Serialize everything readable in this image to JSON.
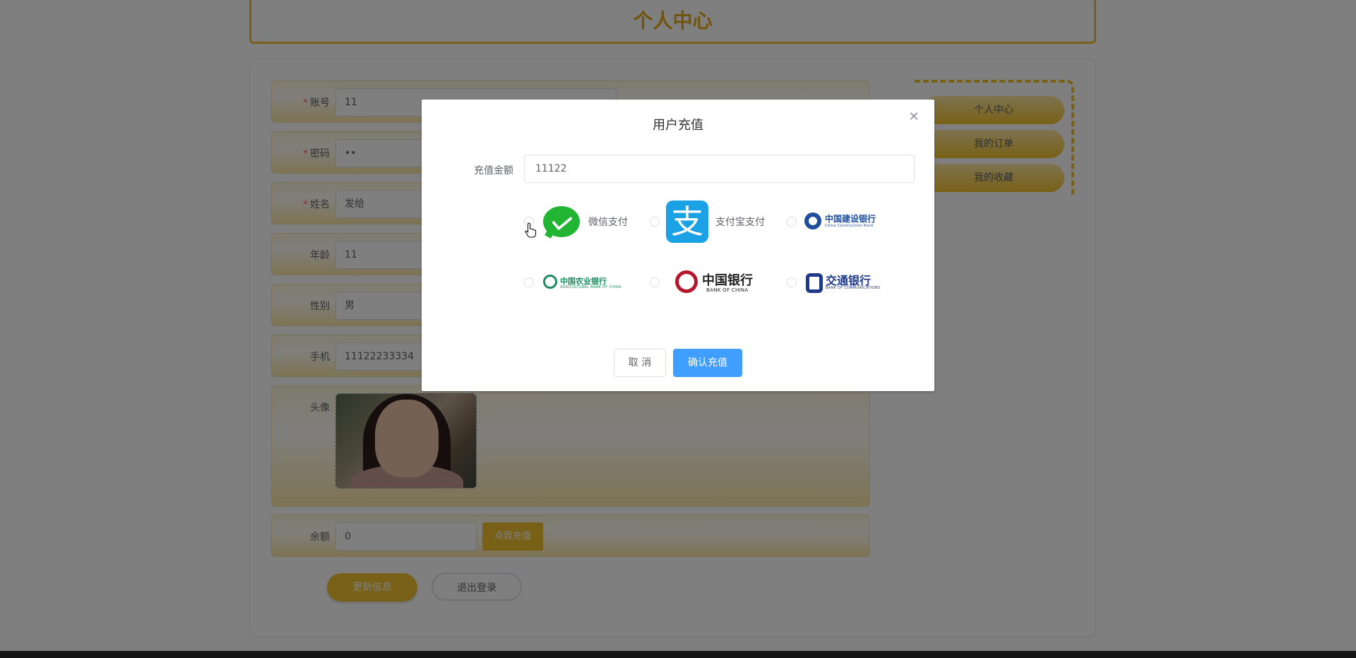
{
  "page": {
    "title": "个人中心"
  },
  "profile_form": {
    "rows": [
      {
        "label": "账号",
        "required": true,
        "value": "11"
      },
      {
        "label": "密码",
        "required": true,
        "value": "••"
      },
      {
        "label": "姓名",
        "required": true,
        "value": "发给"
      },
      {
        "label": "年龄",
        "required": false,
        "value": "11"
      },
      {
        "label": "性别",
        "required": false,
        "value": "男"
      },
      {
        "label": "手机",
        "required": false,
        "value": "11122233334"
      }
    ],
    "required_mark": "*",
    "avatar_label": "头像",
    "balance_label": "余额",
    "balance_value": "0",
    "recharge_link": "点我充值",
    "update_button": "更新信息",
    "logout_button": "退出登录"
  },
  "side_nav": {
    "items": [
      "个人中心",
      "我的订单",
      "我的收藏"
    ]
  },
  "dialog": {
    "title": "用户充值",
    "close_icon": "close-icon",
    "amount_label": "充值金额",
    "amount_value": "11122",
    "payment_options": [
      {
        "name": "wechat",
        "label": "微信支付",
        "color": "#22b533"
      },
      {
        "name": "alipay",
        "label": "支付宝支付",
        "color": "#1aa1e6"
      },
      {
        "name": "ccb",
        "label": "中国建设银行",
        "sublabel": "China Construction Bank",
        "color": "#1e4e9d"
      },
      {
        "name": "abc",
        "label": "中国农业银行",
        "sublabel": "AGRICULTURAL BANK OF CHINA",
        "color": "#1d8a60"
      },
      {
        "name": "boc",
        "label": "中国银行",
        "sublabel": "BANK OF CHINA",
        "color": "#b5162b"
      },
      {
        "name": "bocom",
        "label": "交通银行",
        "sublabel": "BANK OF COMMUNICATIONS",
        "color": "#1f3a8a"
      }
    ],
    "cancel_button": "取 消",
    "confirm_button": "确认充值",
    "confirm_color": "#409eff"
  },
  "colors": {
    "accent": "#f2c12e",
    "required": "#f56c6c"
  }
}
